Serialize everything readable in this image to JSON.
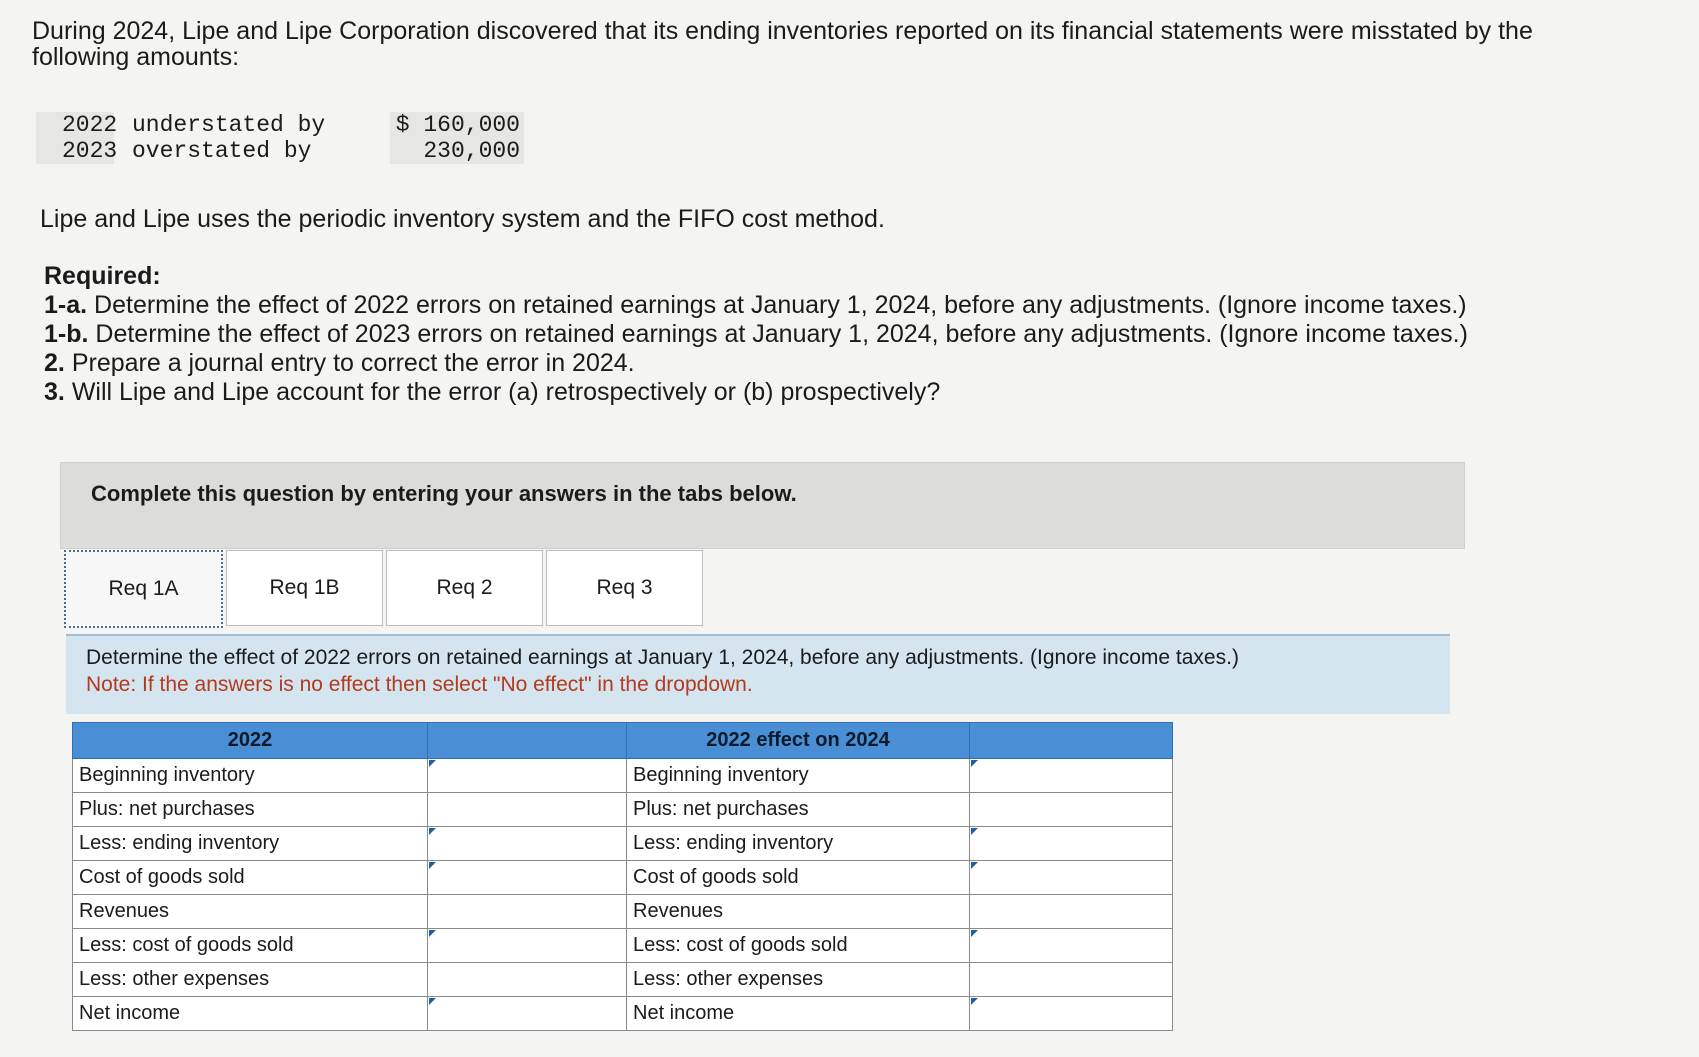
{
  "intro": "During 2024, Lipe and Lipe Corporation discovered that its ending inventories reported on its financial statements were misstated by the following amounts:",
  "amounts": [
    {
      "year": "2022",
      "desc": "understated by",
      "amount": "$ 160,000"
    },
    {
      "year": "2023",
      "desc": "overstated by",
      "amount": "230,000"
    }
  ],
  "method": "Lipe and Lipe uses the periodic inventory system and the FIFO cost method.",
  "required": {
    "heading": "Required:",
    "items": [
      {
        "num": "1-a.",
        "text": "Determine the effect of 2022 errors on retained earnings at January 1, 2024, before any adjustments. (Ignore income taxes.)"
      },
      {
        "num": "1-b.",
        "text": "Determine the effect of 2023 errors on retained earnings at January 1, 2024, before any adjustments. (Ignore income taxes.)"
      },
      {
        "num": "2.",
        "text": "Prepare a journal entry to correct the error in 2024."
      },
      {
        "num": "3.",
        "text": "Will Lipe and Lipe account for the error (a) retrospectively or (b) prospectively?"
      }
    ]
  },
  "panel_message": "Complete this question by entering your answers in the tabs below.",
  "tabs": [
    {
      "label": "Req 1A"
    },
    {
      "label": "Req 1B"
    },
    {
      "label": "Req 2"
    },
    {
      "label": "Req 3"
    }
  ],
  "instructions": {
    "line": "Determine the effect of 2022 errors on retained earnings at January 1, 2024, before any adjustments. (Ignore income taxes.)",
    "note": "Note: If the answers is no effect then select \"No effect\" in the dropdown."
  },
  "table": {
    "header_left": "2022",
    "header_right": "2022 effect on 2024",
    "rows_left": [
      "Beginning inventory",
      "Plus: net purchases",
      "Less: ending inventory",
      "Cost of goods sold",
      "Revenues",
      "Less: cost of goods sold",
      "Less: other expenses",
      "Net income"
    ],
    "rows_right": [
      "Beginning inventory",
      "Plus: net purchases",
      "Less: ending inventory",
      "Cost of goods sold",
      "Revenues",
      "Less: cost of goods sold",
      "Less: other expenses",
      "Net income"
    ]
  }
}
